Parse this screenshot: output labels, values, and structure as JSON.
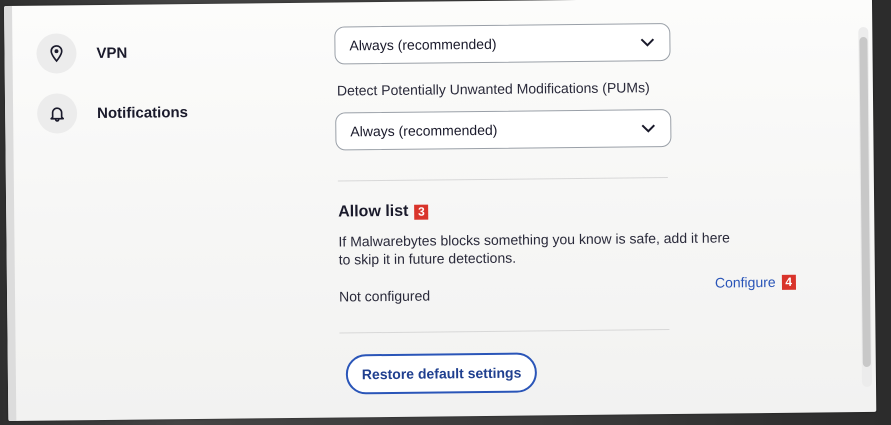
{
  "nav": {
    "items": [
      {
        "label": "VPN",
        "icon": "location-pin-icon"
      },
      {
        "label": "Notifications",
        "icon": "bell-icon"
      }
    ]
  },
  "settings": {
    "vpn_select_value": "Always (recommended)",
    "pum_label": "Detect Potentially Unwanted Modifications (PUMs)",
    "pum_select_value": "Always (recommended)"
  },
  "allow_list": {
    "title": "Allow list",
    "title_badge": "3",
    "description": "If Malwarebytes blocks something you know is safe, add it here to skip it in future detections.",
    "status": "Not configured",
    "configure_label": "Configure",
    "configure_badge": "4"
  },
  "restore_button": {
    "label": "Restore default settings"
  },
  "colors": {
    "accent": "#2a55b8",
    "badge": "#d9342b",
    "text": "#1a1a2b"
  }
}
